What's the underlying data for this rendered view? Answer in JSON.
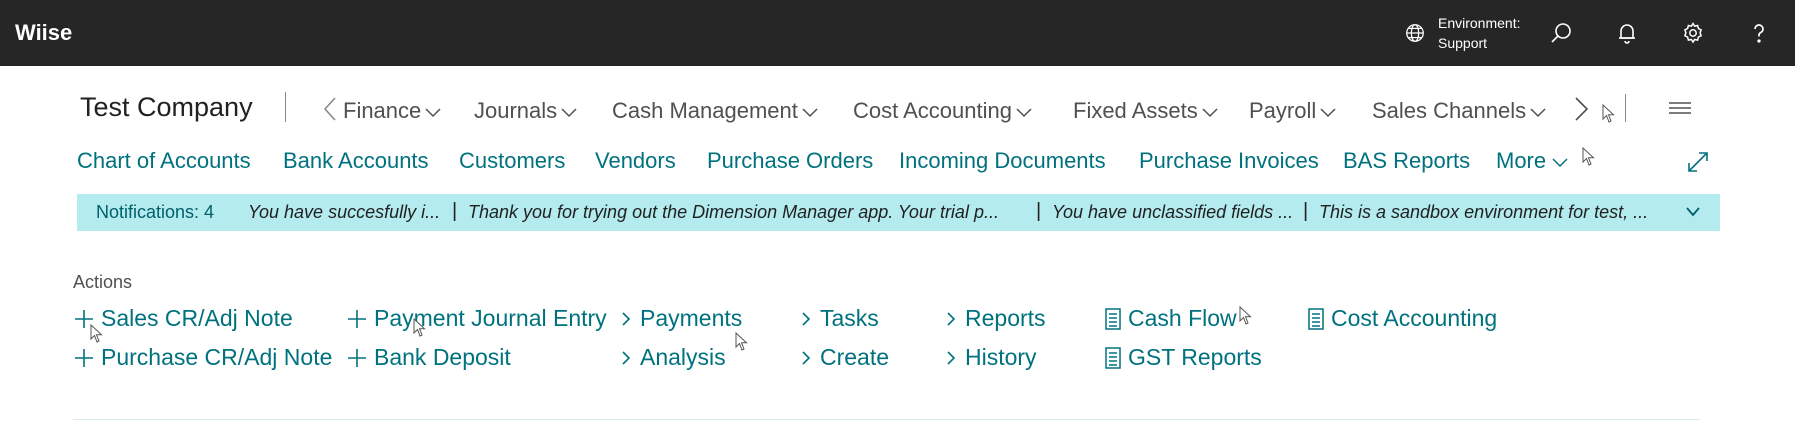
{
  "app": {
    "name": "Wiise"
  },
  "environment": {
    "label": "Environment:",
    "value": "Support"
  },
  "topbar_icons": [
    "globe-icon",
    "search-icon",
    "bell-icon",
    "gear-icon",
    "help-icon"
  ],
  "company": {
    "name": "Test Company"
  },
  "nav_menus": [
    "Finance",
    "Journals",
    "Cash Management",
    "Cost Accounting",
    "Fixed Assets",
    "Payroll",
    "Sales Channels"
  ],
  "quick_links": {
    "items": [
      "Chart of Accounts",
      "Bank Accounts",
      "Customers",
      "Vendors",
      "Purchase Orders",
      "Incoming Documents",
      "Purchase Invoices",
      "BAS Reports"
    ],
    "more": "More"
  },
  "notifications": {
    "count_label": "Notifications: 4",
    "messages": [
      "You have succesfully i...",
      "Thank you for trying out the Dimension Manager app. Your trial p...",
      "You have unclassified fields ...",
      "This is a sandbox environment for test, ..."
    ],
    "separator": "|"
  },
  "actions": {
    "label": "Actions",
    "create": [
      "Sales CR/Adj Note",
      "Purchase CR/Adj Note",
      "Payment Journal Entry",
      "Bank Deposit"
    ],
    "groups": [
      "Payments",
      "Analysis",
      "Tasks",
      "Create",
      "Reports",
      "History"
    ],
    "report_links": [
      "Cash Flow",
      "GST Reports",
      "Cost Accounting"
    ]
  },
  "colors": {
    "topbar": "#262626",
    "accent": "#00727f",
    "notification_bg": "#b4ebee"
  }
}
